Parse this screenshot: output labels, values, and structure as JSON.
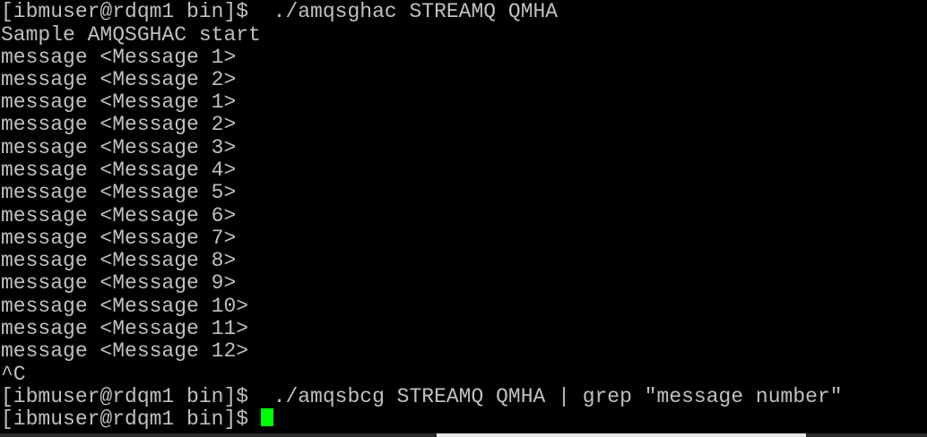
{
  "terminal": {
    "lines": [
      "[ibmuser@rdqm1 bin]$  ./amqsghac STREAMQ QMHA",
      "Sample AMQSGHAC start",
      "message <Message 1>",
      "message <Message 2>",
      "message <Message 1>",
      "message <Message 2>",
      "message <Message 3>",
      "message <Message 4>",
      "message <Message 5>",
      "message <Message 6>",
      "message <Message 7>",
      "message <Message 8>",
      "message <Message 9>",
      "message <Message 10>",
      "message <Message 11>",
      "message <Message 12>",
      "^C",
      "[ibmuser@rdqm1 bin]$  ./amqsbcg STREAMQ QMHA | grep \"message number\"",
      "[ibmuser@rdqm1 bin]$ "
    ],
    "colors": {
      "background": "#000000",
      "text": "#c0c0c0",
      "cursor": "#00ff00"
    }
  }
}
